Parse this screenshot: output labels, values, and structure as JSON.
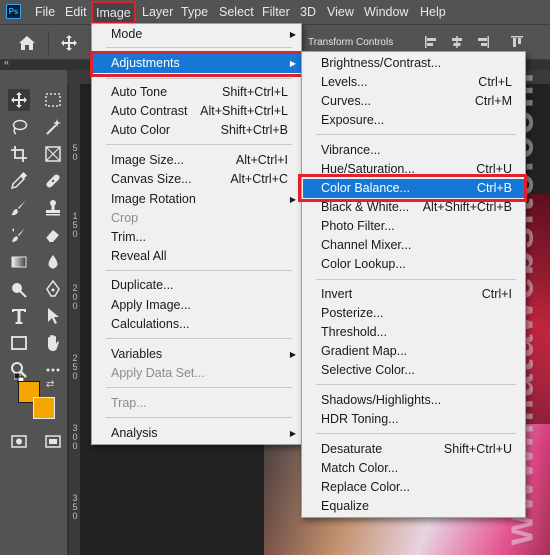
{
  "app": {
    "logo": "Ps"
  },
  "menubar": {
    "items": [
      "File",
      "Edit",
      "Image",
      "Layer",
      "Type",
      "Select",
      "Filter",
      "3D",
      "View",
      "Window",
      "Help"
    ],
    "active": "Image"
  },
  "options_bar": {
    "transform_label": "Transform Controls",
    "home_icon": "home-icon",
    "move_icon": "move-icon"
  },
  "panel": {
    "collapse": "«"
  },
  "ruler": {
    "digits": [
      "5",
      "0",
      "1",
      "5",
      "0",
      "2",
      "0",
      "0",
      "2",
      "5",
      "0",
      "3",
      "0",
      "0",
      "3",
      "5",
      "0"
    ]
  },
  "toolbar": {
    "tools": [
      "move-icon",
      "marquee-icon",
      "lasso-icon",
      "magic-wand-icon",
      "crop-icon",
      "frame-icon",
      "eyedropper-icon",
      "healing-icon",
      "brush-icon",
      "stamp-icon",
      "history-brush-icon",
      "eraser-icon",
      "gradient-icon",
      "blur-icon",
      "dodge-icon",
      "pen-icon",
      "type-icon",
      "path-select-icon",
      "rectangle-icon",
      "hand-icon",
      "zoom-icon",
      "more-icon"
    ],
    "foreground_color": "#f6a600",
    "background_color": "#f6a600"
  },
  "image_menu": {
    "items": [
      {
        "label": "Mode",
        "shortcut": "",
        "submenu": true
      },
      {
        "label": "Adjustments",
        "shortcut": "",
        "submenu": true,
        "highlighted": true
      },
      {
        "label": "Auto Tone",
        "shortcut": "Shift+Ctrl+L"
      },
      {
        "label": "Auto Contrast",
        "shortcut": "Alt+Shift+Ctrl+L"
      },
      {
        "label": "Auto Color",
        "shortcut": "Shift+Ctrl+B"
      },
      {
        "label": "Image Size...",
        "shortcut": "Alt+Ctrl+I"
      },
      {
        "label": "Canvas Size...",
        "shortcut": "Alt+Ctrl+C"
      },
      {
        "label": "Image Rotation",
        "shortcut": "",
        "submenu": true
      },
      {
        "label": "Crop",
        "shortcut": "",
        "disabled": true
      },
      {
        "label": "Trim...",
        "shortcut": ""
      },
      {
        "label": "Reveal All",
        "shortcut": ""
      },
      {
        "label": "Duplicate...",
        "shortcut": ""
      },
      {
        "label": "Apply Image...",
        "shortcut": ""
      },
      {
        "label": "Calculations...",
        "shortcut": ""
      },
      {
        "label": "Variables",
        "shortcut": "",
        "submenu": true
      },
      {
        "label": "Apply Data Set...",
        "shortcut": "",
        "disabled": true
      },
      {
        "label": "Trap...",
        "shortcut": "",
        "disabled": true
      },
      {
        "label": "Analysis",
        "shortcut": "",
        "submenu": true
      }
    ]
  },
  "adjustments_menu": {
    "items": [
      {
        "label": "Brightness/Contrast...",
        "shortcut": ""
      },
      {
        "label": "Levels...",
        "shortcut": "Ctrl+L"
      },
      {
        "label": "Curves...",
        "shortcut": "Ctrl+M"
      },
      {
        "label": "Exposure...",
        "shortcut": ""
      },
      {
        "label": "Vibrance...",
        "shortcut": ""
      },
      {
        "label": "Hue/Saturation...",
        "shortcut": "Ctrl+U"
      },
      {
        "label": "Color Balance...",
        "shortcut": "Ctrl+B",
        "highlighted": true
      },
      {
        "label": "Black & White...",
        "shortcut": "Alt+Shift+Ctrl+B"
      },
      {
        "label": "Photo Filter...",
        "shortcut": ""
      },
      {
        "label": "Channel Mixer...",
        "shortcut": ""
      },
      {
        "label": "Color Lookup...",
        "shortcut": ""
      },
      {
        "label": "Invert",
        "shortcut": "Ctrl+I"
      },
      {
        "label": "Posterize...",
        "shortcut": ""
      },
      {
        "label": "Threshold...",
        "shortcut": ""
      },
      {
        "label": "Gradient Map...",
        "shortcut": ""
      },
      {
        "label": "Selective Color...",
        "shortcut": ""
      },
      {
        "label": "Shadows/Highlights...",
        "shortcut": ""
      },
      {
        "label": "HDR Toning...",
        "shortcut": ""
      },
      {
        "label": "Desaturate",
        "shortcut": "Shift+Ctrl+U"
      },
      {
        "label": "Match Color...",
        "shortcut": ""
      },
      {
        "label": "Replace Color...",
        "shortcut": ""
      },
      {
        "label": "Equalize",
        "shortcut": ""
      }
    ]
  },
  "watermark": "www.matawebsite.com",
  "colors": {
    "highlight": "#1777d6",
    "annotation_red": "#e0202a",
    "ui_gray": "#535353"
  }
}
